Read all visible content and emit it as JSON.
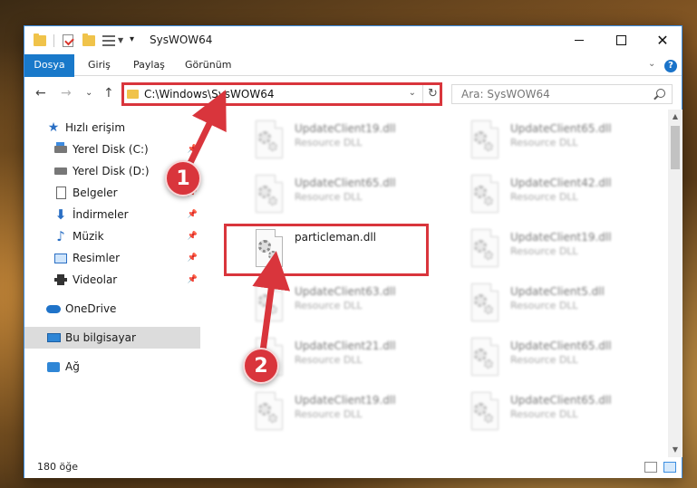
{
  "window": {
    "title": "SysWOW64",
    "minimize_label": "",
    "maximize_label": "",
    "close_label": "✕"
  },
  "ribbon": {
    "tabs": [
      {
        "label": "Dosya"
      },
      {
        "label": "Giriş"
      },
      {
        "label": "Paylaş"
      },
      {
        "label": "Görünüm"
      }
    ],
    "expand_glyph": "⌄",
    "help_glyph": "?"
  },
  "address": {
    "path": "C:\\Windows\\SysWOW64",
    "dropdown_glyph": "⌄",
    "refresh_glyph": "↻",
    "back_glyph": "←",
    "forward_glyph": "→",
    "recent_glyph": "⌄",
    "up_glyph": "↑"
  },
  "search": {
    "placeholder": "Ara: SysWOW64"
  },
  "sidebar": {
    "items": [
      {
        "label": "Hızlı erişim",
        "icon": "star-icon"
      },
      {
        "label": "Yerel Disk (C:)",
        "icon": "drive-c-icon",
        "pinned": true
      },
      {
        "label": "Yerel Disk (D:)",
        "icon": "drive-d-icon",
        "pinned": true
      },
      {
        "label": "Belgeler",
        "icon": "documents-icon",
        "pinned": true
      },
      {
        "label": "İndirmeler",
        "icon": "downloads-icon",
        "pinned": true
      },
      {
        "label": "Müzik",
        "icon": "music-icon",
        "pinned": true
      },
      {
        "label": "Resimler",
        "icon": "pictures-icon",
        "pinned": true
      },
      {
        "label": "Videolar",
        "icon": "videos-icon",
        "pinned": true
      },
      {
        "label": "OneDrive",
        "icon": "cloud-icon"
      },
      {
        "label": "Bu bilgisayar",
        "icon": "computer-icon",
        "selected": true
      },
      {
        "label": "Ağ",
        "icon": "network-icon"
      }
    ]
  },
  "files": {
    "left": [
      {
        "name": "UpdateClient19.dll",
        "type": "Resource DLL",
        "blurred": true
      },
      {
        "name": "UpdateClient65.dll",
        "type": "Resource DLL",
        "blurred": true
      },
      {
        "name": "particleman.dll",
        "type": "",
        "blurred": false
      },
      {
        "name": "UpdateClient63.dll",
        "type": "Resource DLL",
        "blurred": true
      },
      {
        "name": "UpdateClient21.dll",
        "type": "Resource DLL",
        "blurred": true
      },
      {
        "name": "UpdateClient19.dll",
        "type": "Resource DLL",
        "blurred": true
      }
    ],
    "right": [
      {
        "name": "UpdateClient65.dll",
        "type": "Resource DLL",
        "blurred": true
      },
      {
        "name": "UpdateClient42.dll",
        "type": "Resource DLL",
        "blurred": true
      },
      {
        "name": "UpdateClient19.dll",
        "type": "Resource DLL",
        "blurred": true
      },
      {
        "name": "UpdateClient5.dll",
        "type": "Resource DLL",
        "blurred": true
      },
      {
        "name": "UpdateClient65.dll",
        "type": "Resource DLL",
        "blurred": true
      },
      {
        "name": "UpdateClient65.dll",
        "type": "Resource DLL",
        "blurred": true
      }
    ]
  },
  "status": {
    "item_count": "180 öğe"
  },
  "callouts": [
    {
      "number": "1"
    },
    {
      "number": "2"
    }
  ],
  "colors": {
    "accent": "#1979ca",
    "highlight": "#d9353c"
  }
}
